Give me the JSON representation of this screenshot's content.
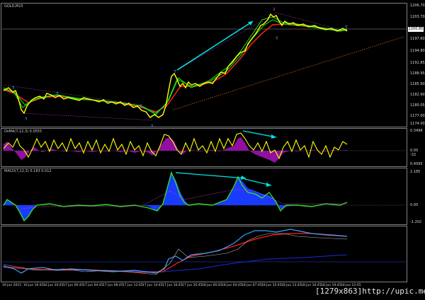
{
  "panels": {
    "price": {
      "label": "GOLD,M15"
    },
    "osma": {
      "label": "OsMA(7,12,3) 0.0555"
    },
    "macd": {
      "label": "MACD(7,12,3) 0.183 0.012"
    }
  },
  "price_axis": [
    "1206.70",
    "1203.70",
    "1200.85",
    "1197.60",
    "1194.80",
    "1191.85",
    "1188.95",
    "1185.90",
    "1182.90",
    "1180.05",
    "1177.00",
    "1174.00"
  ],
  "current_price": "1200.85",
  "osma_axis": [
    "0.3498",
    "0.00",
    "0.4095"
  ],
  "osma_extra": "-32",
  "macd_axis": [
    "2.185",
    "0.00",
    "-1.202"
  ],
  "time_axis": [
    "16 Jun 2015",
    "16 Jun 16:45",
    "16 Jun 20:45",
    "17 Jun 00:45",
    "17 Jun 04:45",
    "17 Jun 08:45",
    "17 Jun 12:45",
    "17 Jun 14:45",
    "17 Jun 16:45",
    "17 Jun 20:45",
    "18 Jun 00:45",
    "18 Jun 04:45",
    "18 Jun 07:45",
    "18 Jun 10:45",
    "18 Jun 13:45",
    "18 Jun 16:45",
    "18 Jun 19:45",
    "18 Jun 22:45",
    "19 Jun 04:45",
    "19 Jun 07:45"
  ],
  "watermark": "[1279x863]http://upic.me/",
  "colors": {
    "background": "#000000",
    "price": "#ffff00",
    "ma_green": "#00d800",
    "ma_red": "#ff2020",
    "trend_arrow": "#00e5e5",
    "divergence_line": "#b040c0",
    "osma_hist": "#9010a0",
    "macd_fill": "#1a3aff",
    "macd_line": "#33dd22",
    "signal_dots": "#cc44cc"
  }
}
